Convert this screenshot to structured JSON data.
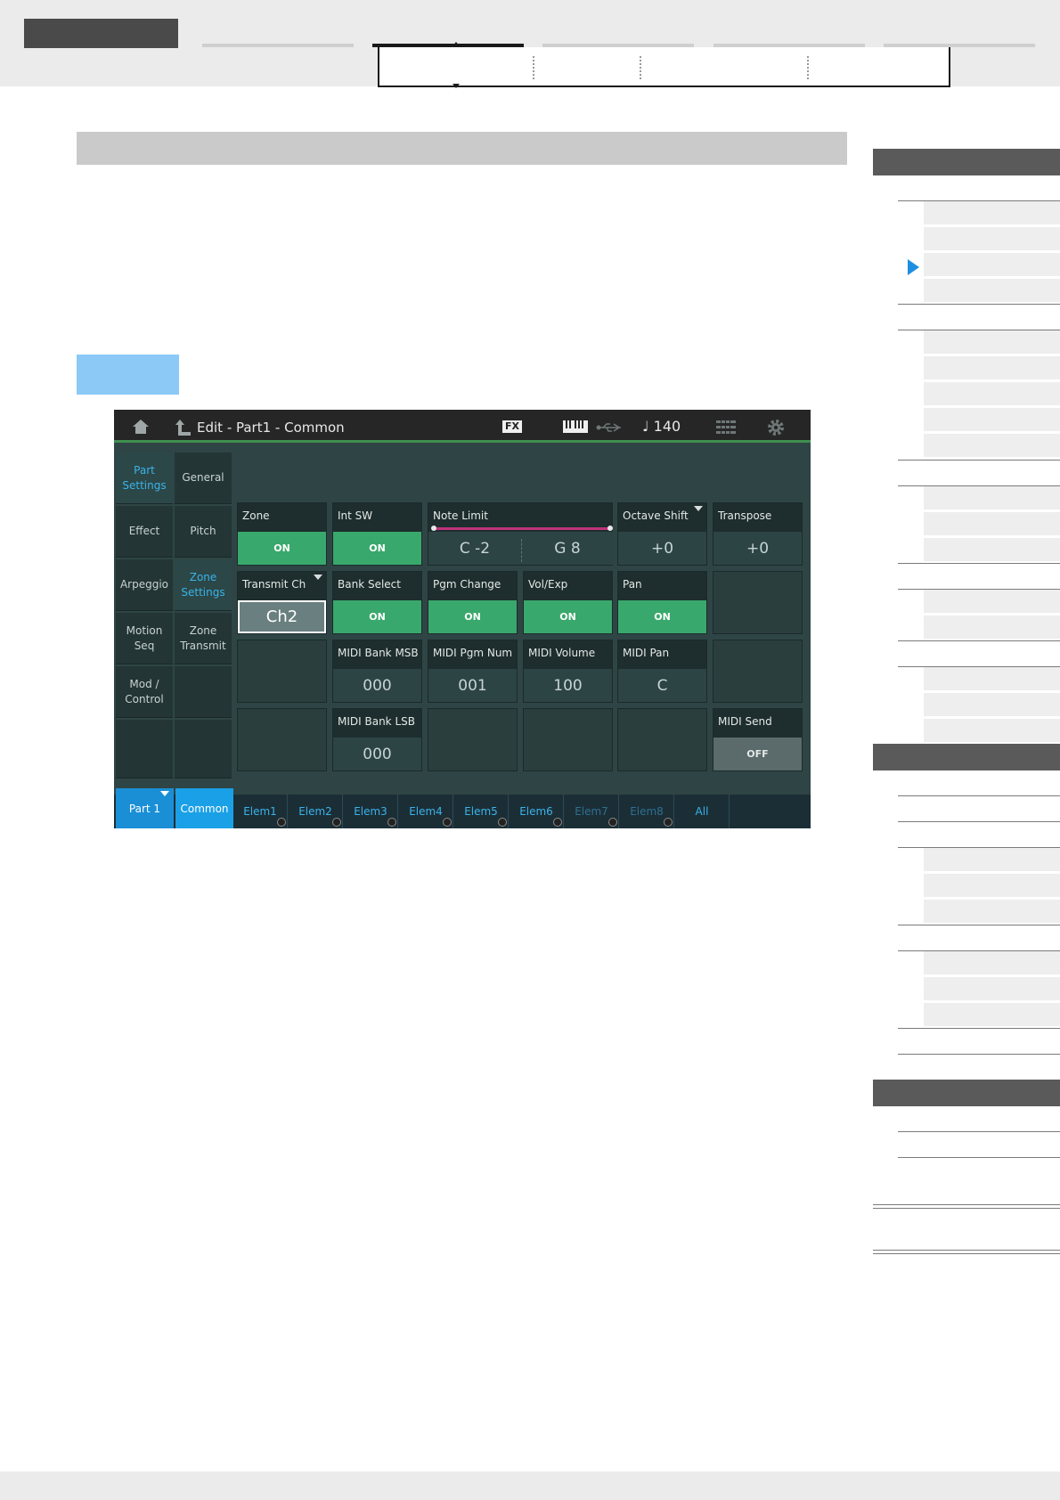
{
  "screen": {
    "title": "Edit - Part1 - Common",
    "fx_label": "FX",
    "tempo": "♩ 140",
    "left_nav": [
      [
        "Part Settings",
        "General"
      ],
      [
        "Effect",
        "Pitch"
      ],
      [
        "Arpeggio",
        "Zone Settings"
      ],
      [
        "Motion Seq",
        "Zone Transmit"
      ],
      [
        "Mod / Control",
        ""
      ],
      [
        "",
        ""
      ]
    ],
    "params": {
      "zone": {
        "label": "Zone",
        "value": "ON"
      },
      "int_sw": {
        "label": "Int SW",
        "value": "ON"
      },
      "note_limit": {
        "label": "Note Limit",
        "low": "C -2",
        "high": "G 8"
      },
      "octave_shift": {
        "label": "Octave Shift",
        "value": "+0"
      },
      "transpose": {
        "label": "Transpose",
        "value": "+0"
      },
      "transmit_ch": {
        "label": "Transmit Ch",
        "value": "Ch2"
      },
      "bank_select": {
        "label": "Bank Select",
        "value": "ON"
      },
      "pgm_change": {
        "label": "Pgm Change",
        "value": "ON"
      },
      "vol_exp": {
        "label": "Vol/Exp",
        "value": "ON"
      },
      "pan": {
        "label": "Pan",
        "value": "ON"
      },
      "midi_bank_msb": {
        "label": "MIDI Bank MSB",
        "value": "000"
      },
      "midi_pgm_num": {
        "label": "MIDI Pgm Num",
        "value": "001"
      },
      "midi_volume": {
        "label": "MIDI Volume",
        "value": "100"
      },
      "midi_pan": {
        "label": "MIDI Pan",
        "value": "C"
      },
      "midi_bank_lsb": {
        "label": "MIDI Bank LSB",
        "value": "000"
      },
      "midi_send": {
        "label": "MIDI Send",
        "value": "OFF"
      }
    },
    "bottom_tabs": {
      "part": "Part 1",
      "common": "Common",
      "elements": [
        "Elem1",
        "Elem2",
        "Elem3",
        "Elem4",
        "Elem5",
        "Elem6",
        "Elem7",
        "Elem8",
        "All"
      ]
    }
  }
}
